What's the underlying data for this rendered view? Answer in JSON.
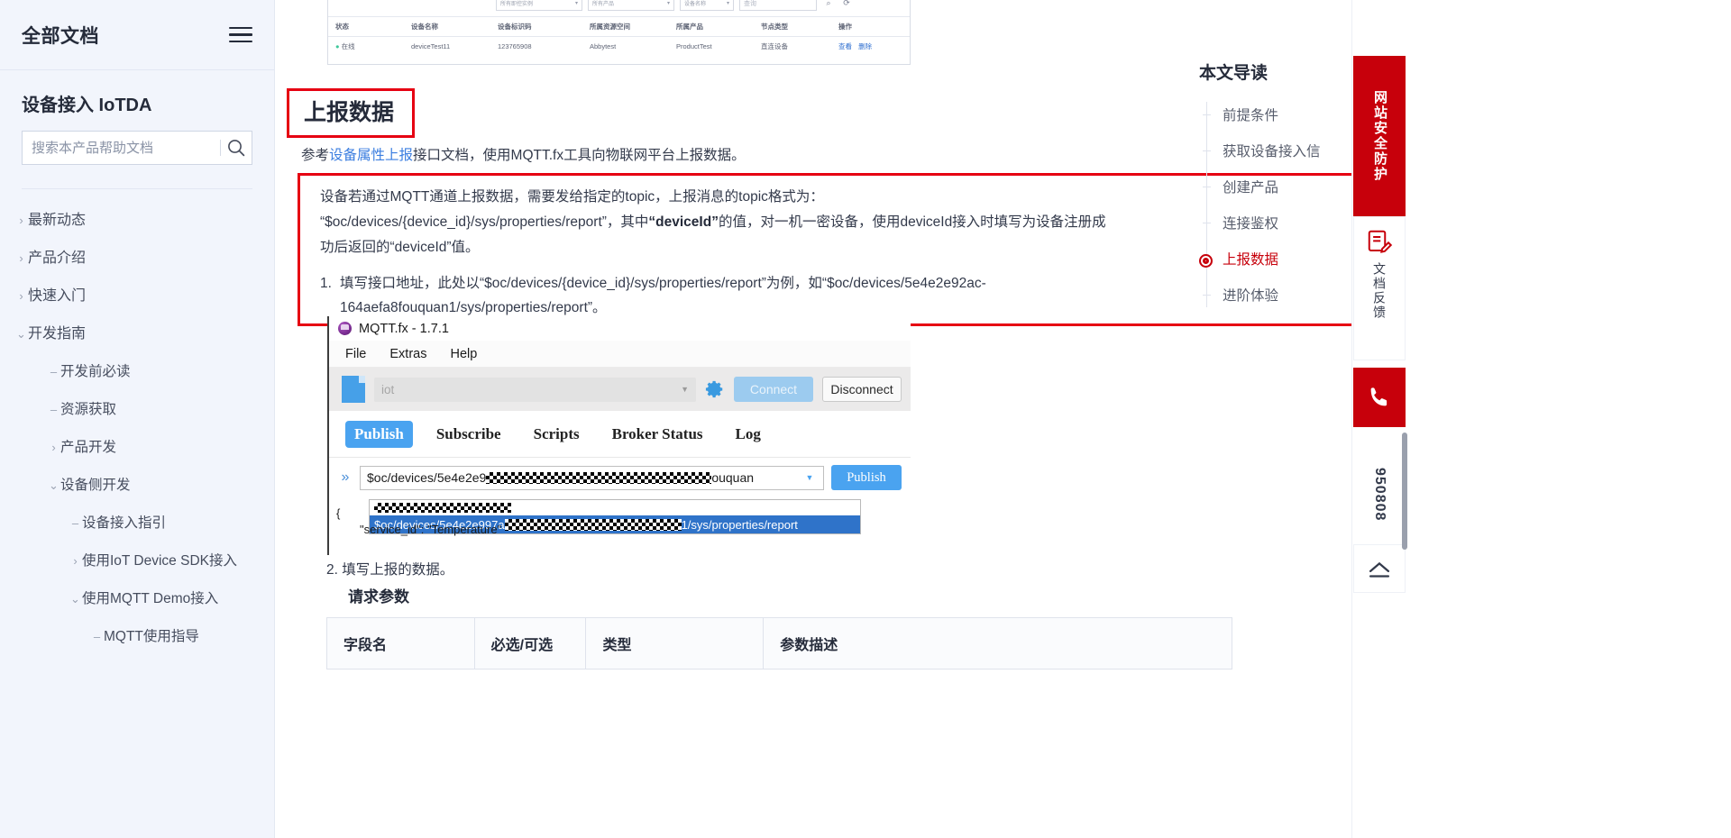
{
  "sidebar": {
    "all_docs": "全部文档",
    "menu_icon": "hamburger-icon",
    "product_title": "设备接入 IoTDA",
    "search_placeholder": "搜索本产品帮助文档",
    "search_value": "",
    "nav": [
      {
        "label": "最新动态",
        "level": 0,
        "marker": "chevron-right"
      },
      {
        "label": "产品介绍",
        "level": 0,
        "marker": "chevron-right"
      },
      {
        "label": "快速入门",
        "level": 0,
        "marker": "chevron-right"
      },
      {
        "label": "开发指南",
        "level": 0,
        "marker": "chevron-down"
      },
      {
        "label": "开发前必读",
        "level": 1,
        "marker": "dash"
      },
      {
        "label": "资源获取",
        "level": 1,
        "marker": "dash"
      },
      {
        "label": "产品开发",
        "level": 1,
        "marker": "chevron-right"
      },
      {
        "label": "设备侧开发",
        "level": 1,
        "marker": "chevron-down"
      },
      {
        "label": "设备接入指引",
        "level": 2,
        "marker": "dash"
      },
      {
        "label": "使用IoT Device SDK接入",
        "level": 2,
        "marker": "chevron-right"
      },
      {
        "label": "使用MQTT Demo接入",
        "level": 2,
        "marker": "chevron-down"
      },
      {
        "label": "MQTT使用指导",
        "level": 3,
        "marker": "dash"
      }
    ]
  },
  "console_shot": {
    "filters": [
      {
        "value": "所有即控实例",
        "name": "instance-select"
      },
      {
        "value": "所有产品",
        "name": "product-select"
      },
      {
        "value": "设备名称",
        "name": "field-select"
      }
    ],
    "search_placeholder": "查询",
    "search_icon": "search-icon",
    "refresh_icon": "refresh-icon",
    "headers": [
      "状态",
      "设备名称",
      "设备标识码",
      "所属资源空间",
      "所属产品",
      "节点类型",
      "操作"
    ],
    "rows": [
      {
        "status": "在线",
        "device_name": "deviceTest11",
        "node_id": "123765908",
        "space": "Abbytest",
        "product": "ProductTest",
        "node_type": "直连设备",
        "actions": [
          "查看",
          "删除"
        ]
      }
    ]
  },
  "content": {
    "section_title": "上报数据",
    "intro_prefix": "参考",
    "intro_link": "设备属性上报",
    "intro_suffix": "接口文档，使用MQTT.fx工具向物联网平台上报数据。",
    "box_line1": "设备若通过MQTT通道上报数据，需要发给指定的topic，上报消息的topic格式为：",
    "box_line2_a": "“$oc/devices/{device_id}/sys/properties/report”，其中",
    "box_line2_b": "“deviceId”",
    "box_line2_c": "的值，对一机一密设备，使用deviceId接入时填写为设备注册成",
    "box_line3": "功后返回的“deviceId”值。",
    "step1_num": "1.",
    "step1_text": "填写接口地址，此处以“$oc/devices/{device_id}/sys/properties/report”为例，如“$oc/devices/5e4e2e92ac-",
    "step1_text2": "164aefa8fouquan1/sys/properties/report”。",
    "step2_num": "2.",
    "step2_text": "填写上报的数据。",
    "request_params_title": "请求参数",
    "table_headers": [
      "字段名",
      "必选/可选",
      "类型",
      "参数描述"
    ]
  },
  "mqttfx": {
    "window_title": "MQTT.fx - 1.7.1",
    "app_icon": "mqttfx-logo-icon",
    "menu": [
      "File",
      "Extras",
      "Help"
    ],
    "profile_value": "iot",
    "profile_dropdown_icon": "chevron-down-icon",
    "gear_icon": "gear-icon",
    "connect_label": "Connect",
    "disconnect_label": "Disconnect",
    "tabs": [
      {
        "label": "Publish",
        "active": true
      },
      {
        "label": "Subscribe",
        "active": false
      },
      {
        "label": "Scripts",
        "active": false
      },
      {
        "label": "Broker Status",
        "active": false
      },
      {
        "label": "Log",
        "active": false
      }
    ],
    "expand_icon": "chevrons-right-icon",
    "topic_prefix": "$oc/devices/5e4e2e9",
    "topic_suffix": "ouquan",
    "topic_dropdown_icon": "chevron-down-icon",
    "publish_label": "Publish",
    "suggest_selected_prefix": "$oc/devices/5e4e2e997a",
    "suggest_selected_suffix": "1/sys/properties/report",
    "code_line1": "{",
    "code_line2": "\"service_id\": \"Temperature\""
  },
  "toc": {
    "title": "本文导读",
    "items": [
      {
        "label": "前提条件",
        "active": false
      },
      {
        "label": "获取设备接入信",
        "active": false
      },
      {
        "label": "创建产品",
        "active": false
      },
      {
        "label": "连接鉴权",
        "active": false
      },
      {
        "label": "上报数据",
        "active": true
      },
      {
        "label": "进阶体验",
        "active": false
      }
    ]
  },
  "rail": {
    "security_label": "网站安全防护",
    "feedback_label": "文档反馈",
    "feedback_icon": "edit-document-icon",
    "phone_icon": "phone-icon",
    "hotline": "950808",
    "back_to_top_icon": "chevron-up-icon"
  },
  "colors": {
    "accent_red": "#c7000b",
    "highlight_red": "#e60012",
    "link_blue": "#3b7ee0",
    "mqtt_blue": "#4aa3f0",
    "sidebar_bg": "#f2f5fc"
  }
}
